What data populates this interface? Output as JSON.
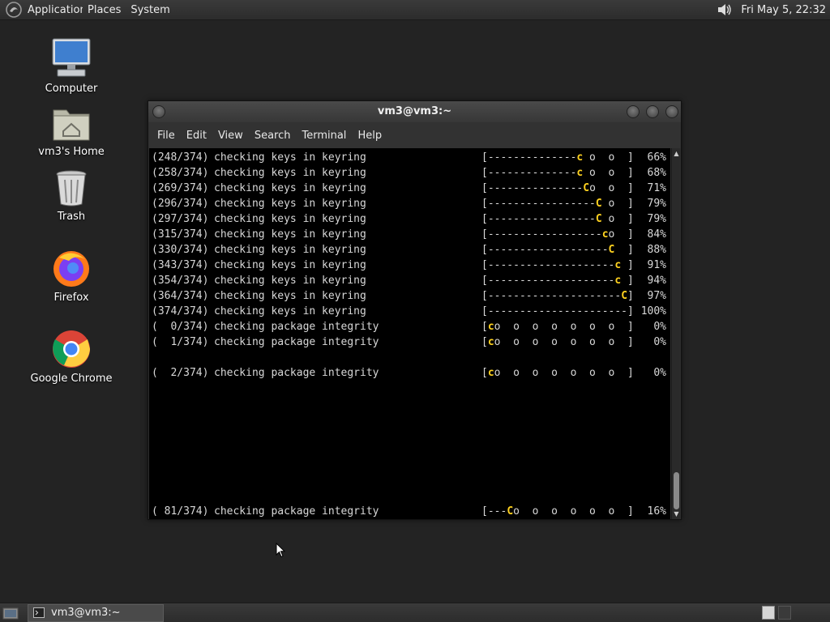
{
  "top_panel": {
    "menus": [
      "Applications",
      "Places",
      "System"
    ],
    "clock": "Fri May  5, 22:32",
    "icons": {
      "menu_logo": "mate-logo-icon",
      "volume": "speaker-volume-icon"
    }
  },
  "desktop_icons": [
    {
      "label": "Computer",
      "icon": "computer-icon"
    },
    {
      "label": "vm3's Home",
      "icon": "home-folder-icon"
    },
    {
      "label": "Trash",
      "icon": "trash-icon"
    },
    {
      "label": "Firefox",
      "icon": "firefox-icon"
    },
    {
      "label": "Google Chrome",
      "icon": "chrome-icon"
    }
  ],
  "terminal": {
    "title": "vm3@vm3:~",
    "menu": [
      "File",
      "Edit",
      "View",
      "Search",
      "Terminal",
      "Help"
    ],
    "lines": [
      {
        "idx": "(248/374)",
        "msg": "checking keys in keyring",
        "bar_pre": "[--------------",
        "pac": "c",
        "bar_post": " o  o  ]",
        "pct": "66%"
      },
      {
        "idx": "(258/374)",
        "msg": "checking keys in keyring",
        "bar_pre": "[--------------",
        "pac": "c",
        "bar_post": " o  o  ]",
        "pct": "68%"
      },
      {
        "idx": "(269/374)",
        "msg": "checking keys in keyring",
        "bar_pre": "[---------------",
        "pac": "C",
        "bar_post": "o  o  ]",
        "pct": "71%"
      },
      {
        "idx": "(296/374)",
        "msg": "checking keys in keyring",
        "bar_pre": "[-----------------",
        "pac": "C",
        "bar_post": " o  ]",
        "pct": "79%"
      },
      {
        "idx": "(297/374)",
        "msg": "checking keys in keyring",
        "bar_pre": "[-----------------",
        "pac": "C",
        "bar_post": " o  ]",
        "pct": "79%"
      },
      {
        "idx": "(315/374)",
        "msg": "checking keys in keyring",
        "bar_pre": "[------------------",
        "pac": "c",
        "bar_post": "o  ]",
        "pct": "84%"
      },
      {
        "idx": "(330/374)",
        "msg": "checking keys in keyring",
        "bar_pre": "[-------------------",
        "pac": "C",
        "bar_post": "  ]",
        "pct": "88%"
      },
      {
        "idx": "(343/374)",
        "msg": "checking keys in keyring",
        "bar_pre": "[--------------------",
        "pac": "c",
        "bar_post": " ]",
        "pct": "91%"
      },
      {
        "idx": "(354/374)",
        "msg": "checking keys in keyring",
        "bar_pre": "[--------------------",
        "pac": "c",
        "bar_post": " ]",
        "pct": "94%"
      },
      {
        "idx": "(364/374)",
        "msg": "checking keys in keyring",
        "bar_pre": "[---------------------",
        "pac": "C",
        "bar_post": "]",
        "pct": "97%"
      },
      {
        "idx": "(374/374)",
        "msg": "checking keys in keyring",
        "bar_pre": "[----------------------]",
        "pac": "",
        "bar_post": "",
        "pct": "100%"
      },
      {
        "idx": "(  0/374)",
        "msg": "checking package integrity",
        "bar_pre": "[",
        "pac": "c",
        "bar_post": "o  o  o  o  o  o  o  ]",
        "pct": "0%"
      },
      {
        "idx": "(  1/374)",
        "msg": "checking package integrity",
        "bar_pre": "[",
        "pac": "c",
        "bar_post": "o  o  o  o  o  o  o  ]",
        "pct": "0%"
      },
      {
        "idx": "",
        "msg": "",
        "bar_pre": "",
        "pac": "",
        "bar_post": "",
        "pct": ""
      },
      {
        "idx": "(  2/374)",
        "msg": "checking package integrity",
        "bar_pre": "[",
        "pac": "c",
        "bar_post": "o  o  o  o  o  o  o  ]",
        "pct": "0%"
      }
    ],
    "last_line": {
      "idx": "( 81/374)",
      "msg": "checking package integrity",
      "bar_pre": "[---",
      "pac": "C",
      "bar_post": "o  o  o  o  o  o  ]",
      "pct": "16%"
    },
    "colors": {
      "background": "#000000",
      "text": "#d8d8d8",
      "pacman": "#ffd21f"
    }
  },
  "bottom_panel": {
    "task_label": "vm3@vm3:~",
    "icons": {
      "show_desktop": "show-desktop-icon",
      "task": "terminal-icon"
    }
  }
}
